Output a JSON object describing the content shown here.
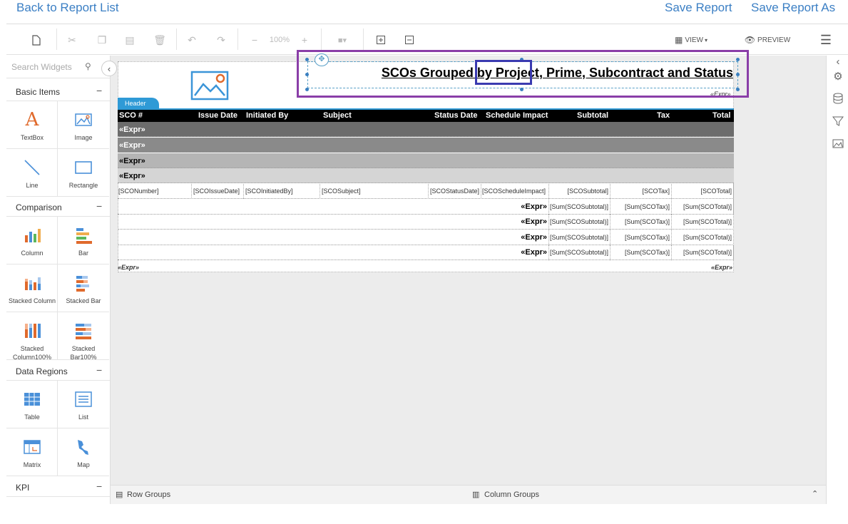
{
  "top": {
    "back": "Back to Report List",
    "save": "Save Report",
    "save_as": "Save Report As"
  },
  "toolbar": {
    "zoom": "100%",
    "view": "VIEW",
    "preview": "PREVIEW"
  },
  "sidebar": {
    "search_placeholder": "Search Widgets",
    "sections": {
      "basic": "Basic Items",
      "comparison": "Comparison",
      "data_regions": "Data Regions",
      "kpi": "KPI"
    },
    "widgets": {
      "textbox": "TextBox",
      "image": "Image",
      "line": "Line",
      "rectangle": "Rectangle",
      "column": "Column",
      "bar": "Bar",
      "stacked_column": "Stacked Column",
      "stacked_bar": "Stacked Bar",
      "stacked_column100": "Stacked Column100%",
      "stacked_bar100": "Stacked Bar100%",
      "table": "Table",
      "list": "List",
      "matrix": "Matrix",
      "map": "Map"
    }
  },
  "report": {
    "header_tab": "Header",
    "title_pre": "SCOs Grouped by ",
    "title_hl": "Project",
    "title_post": ", Prime, Subcontract and Status",
    "expr": "«Expr»",
    "columns": [
      "SCO #",
      "Issue Date",
      "Initiated By",
      "Subject",
      "Status Date",
      "Schedule Impact",
      "Subtotal",
      "Tax",
      "Total"
    ],
    "groups": [
      "«Expr»",
      "«Expr»",
      "«Expr»",
      "«Expr»"
    ],
    "detail": [
      "[SCONumber]",
      "[SCOIssueDate]",
      "[SCOInitiatedBy]",
      "[SCOSubject]",
      "[SCOStatusDate]",
      "[SCOScheduleImpact]",
      "[SCOSubtotal]",
      "[SCOTax]",
      "[SCOTotal]"
    ],
    "totals": {
      "label": "«Expr»",
      "sub": "[Sum(SCOSubtotal)]",
      "tax": "[Sum(SCOTax)]",
      "total": "[Sum(SCOTotal)]"
    }
  },
  "bottom": {
    "row_groups": "Row Groups",
    "column_groups": "Column Groups"
  },
  "colors": {
    "accent": "#3b7fc4",
    "header_tab": "#2f9ad6",
    "highlight_purple": "#8a3ea8",
    "highlight_blue": "#3a3ab0"
  }
}
